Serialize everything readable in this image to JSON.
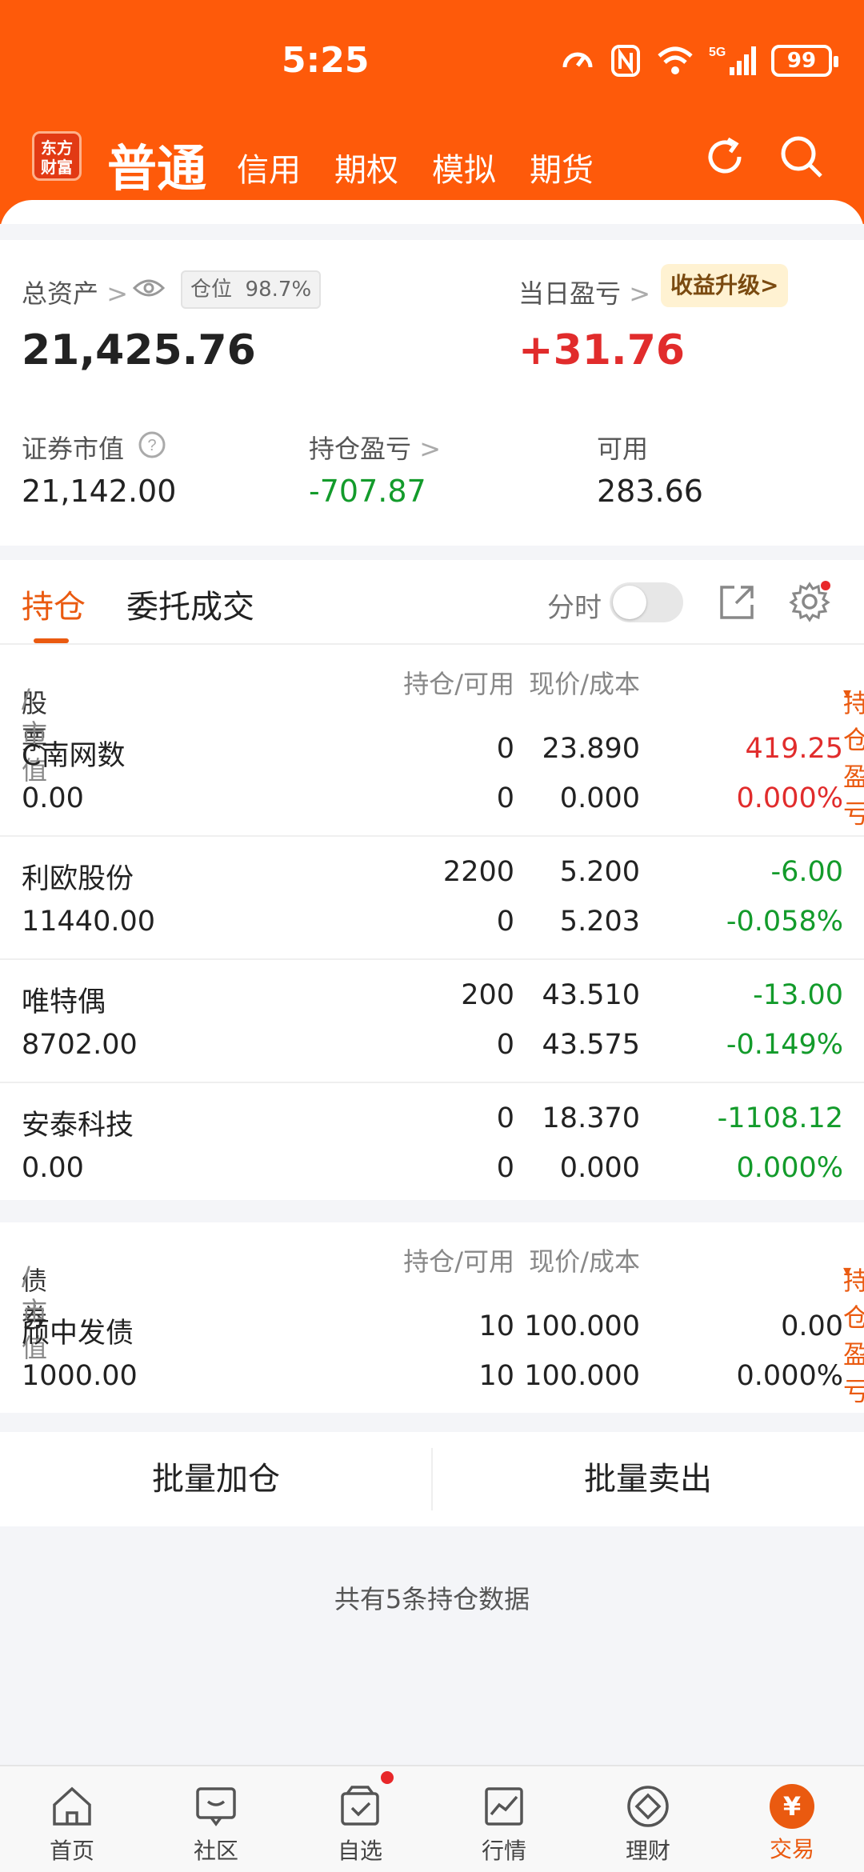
{
  "status": {
    "time": "5:25",
    "battery": "99",
    "signal_label": "5G"
  },
  "header": {
    "logo_line1": "东方",
    "logo_line2": "财富",
    "tabs": [
      "普通",
      "信用",
      "期权",
      "模拟",
      "期货"
    ],
    "active_tab": "普通"
  },
  "assets": {
    "total_label": "总资产",
    "position_label": "仓位",
    "position_ratio": "98.7%",
    "total_value": "21,425.76",
    "daily_pl_label": "当日盈亏",
    "daily_pl_value": "+31.76",
    "market_value_label": "证券市值",
    "market_value": "21,142.00",
    "holding_pl_label": "持仓盈亏",
    "holding_pl_value": "-707.87",
    "available_label": "可用",
    "available_value": "283.66",
    "upgrade_label": "收益升级>"
  },
  "positions": {
    "tabs": [
      "持仓",
      "委托成交"
    ],
    "timeshare_label": "分时",
    "stock_header": {
      "name": "股票",
      "name_sub": "/市值",
      "qty": "持仓/可用",
      "price": "现价/成本",
      "pl": "持仓盈亏"
    },
    "stocks": [
      {
        "name": "C南网数",
        "market_value": "0.00",
        "qty": "0",
        "available": "0",
        "price": "23.890",
        "cost": "0.000",
        "pl": "419.25",
        "pl_pct": "0.000%",
        "pl_color": "red",
        "pct_color": "red"
      },
      {
        "name": "利欧股份",
        "market_value": "11440.00",
        "qty": "2200",
        "available": "0",
        "price": "5.200",
        "cost": "5.203",
        "pl": "-6.00",
        "pl_pct": "-0.058%",
        "pl_color": "green",
        "pct_color": "green"
      },
      {
        "name": "唯特偶",
        "market_value": "8702.00",
        "qty": "200",
        "available": "0",
        "price": "43.510",
        "cost": "43.575",
        "pl": "-13.00",
        "pl_pct": "-0.149%",
        "pl_color": "green",
        "pct_color": "green"
      },
      {
        "name": "安泰科技",
        "market_value": "0.00",
        "qty": "0",
        "available": "0",
        "price": "18.370",
        "cost": "0.000",
        "pl": "-1108.12",
        "pl_pct": "0.000%",
        "pl_color": "green",
        "pct_color": "green"
      }
    ],
    "bond_header": {
      "name": "债券",
      "name_sub": "/市值",
      "qty": "持仓/可用",
      "price": "现价/成本",
      "pl": "持仓盈亏"
    },
    "bonds": [
      {
        "name": "颀中发债",
        "market_value": "1000.00",
        "qty": "10",
        "available": "10",
        "price": "100.000",
        "cost": "100.000",
        "pl": "0.00",
        "pl_pct": "0.000%",
        "pl_color": "dark",
        "pct_color": "dark"
      }
    ],
    "batch_add": "批量加仓",
    "batch_sell": "批量卖出",
    "summary": "共有5条持仓数据"
  },
  "bottom_nav": [
    {
      "label": "首页",
      "icon": "home-icon"
    },
    {
      "label": "社区",
      "icon": "community-icon"
    },
    {
      "label": "自选",
      "icon": "watchlist-icon"
    },
    {
      "label": "行情",
      "icon": "market-icon"
    },
    {
      "label": "理财",
      "icon": "wealth-icon"
    },
    {
      "label": "交易",
      "icon": "trade-icon"
    }
  ],
  "colors": {
    "brand": "#fe5a0a",
    "up": "#e12c2c",
    "down": "#139b2b",
    "accent": "#ea5a10"
  }
}
